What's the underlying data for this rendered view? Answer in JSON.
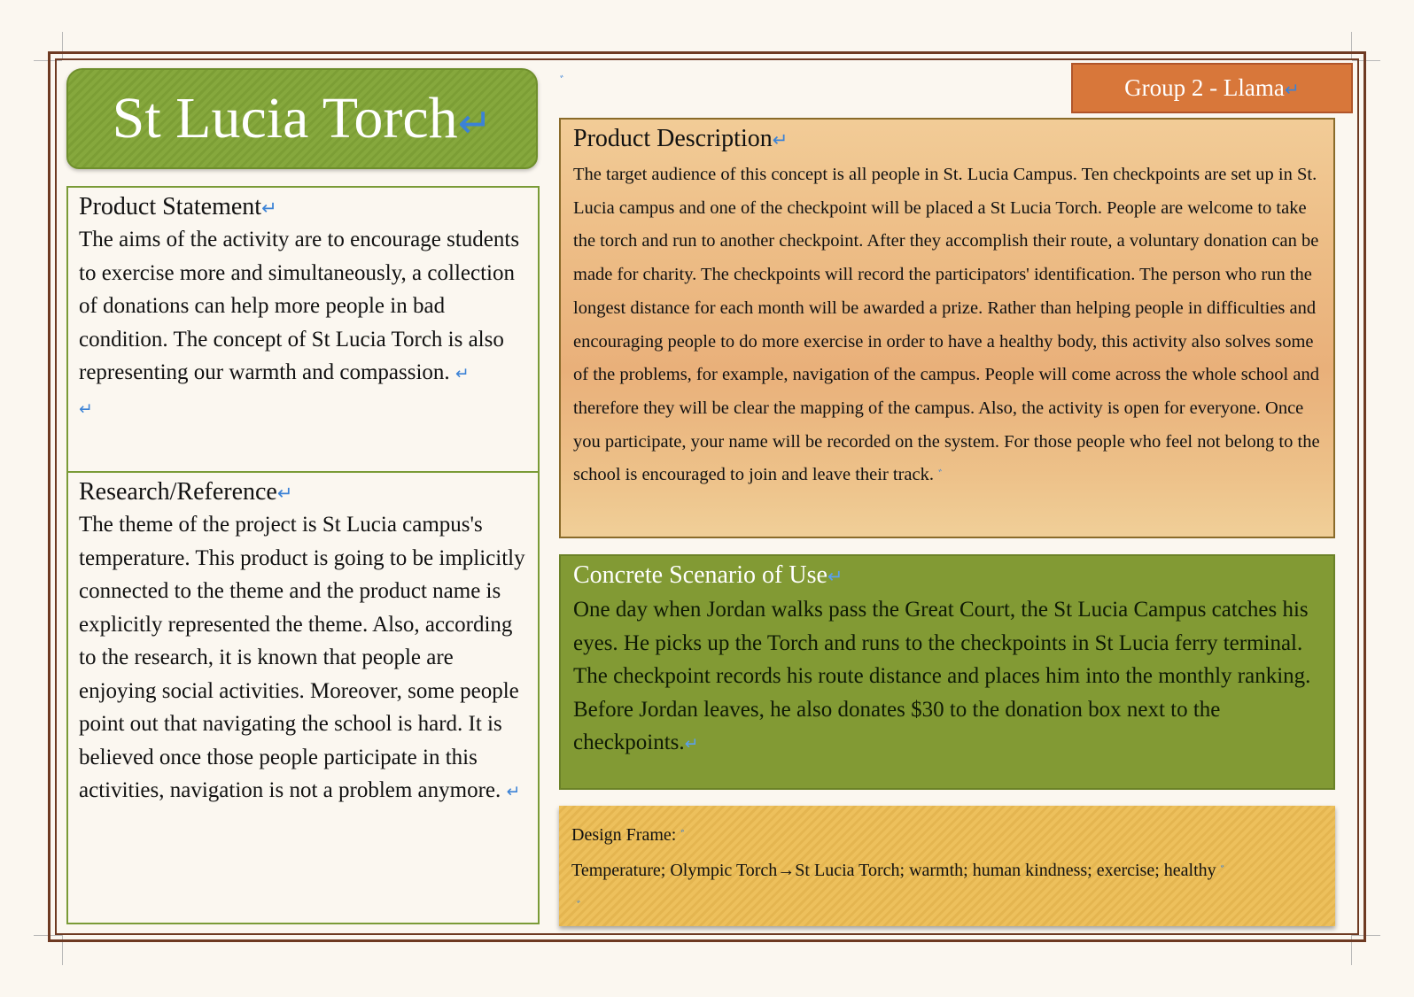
{
  "title": "St Lucia Torch",
  "group_label": "Group 2 - Llama",
  "product_statement": {
    "heading": "Product Statement",
    "body": "The aims of the activity are to encourage students to exercise more and simultaneously, a collection of donations can help more people in bad condition. The concept of St Lucia Torch is also representing our warmth and compassion."
  },
  "research": {
    "heading": "Research/Reference",
    "body": "The theme of the project is St Lucia campus's temperature. This product is going to be implicitly connected to the theme and the product name is explicitly represented the theme. Also, according to the research, it is known that people are enjoying social activities. Moreover, some people point out that navigating the school is hard. It is believed once those people participate in this activities, navigation is not a problem anymore."
  },
  "product_description": {
    "heading": "Product Description",
    "body": "The target audience of this concept is all people in St. Lucia Campus. Ten checkpoints are set up in St. Lucia campus and one of the checkpoint will be placed a St Lucia Torch. People are welcome to take the torch and run to another checkpoint. After they accomplish their route, a voluntary donation can be made for charity. The checkpoints will record the participators' identification. The person who run the longest distance for each month will be awarded a prize. Rather than helping people in difficulties and encouraging people to do more exercise in order to have a healthy body, this activity also solves some of the problems, for example, navigation of the campus. People will come across the whole school and therefore they will be clear the mapping of the campus. Also, the activity is open for everyone. Once you participate, your name will be recorded on the system. For those people who feel not belong to the school is encouraged to join and leave their track."
  },
  "scenario": {
    "heading": "Concrete Scenario of  Use",
    "body": "One day when Jordan walks pass the Great Court, the St Lucia Campus catches his eyes. He picks up the Torch and runs to the checkpoints in St Lucia ferry terminal. The checkpoint records his route distance and places him into the monthly ranking. Before Jordan leaves, he also donates $30 to the donation box next to the checkpoints."
  },
  "design_frame": {
    "label": "Design Frame:",
    "body": "Temperature; Olympic Torch→St Lucia Torch; warmth; human kindness; exercise; healthy"
  },
  "colors": {
    "frame": "#6e3a22",
    "title_green": "#86a83d",
    "group_orange": "#d8773a",
    "scenario_green": "#829a34",
    "design_yellow": "#edc05c",
    "description_tan": "#edbd86"
  }
}
